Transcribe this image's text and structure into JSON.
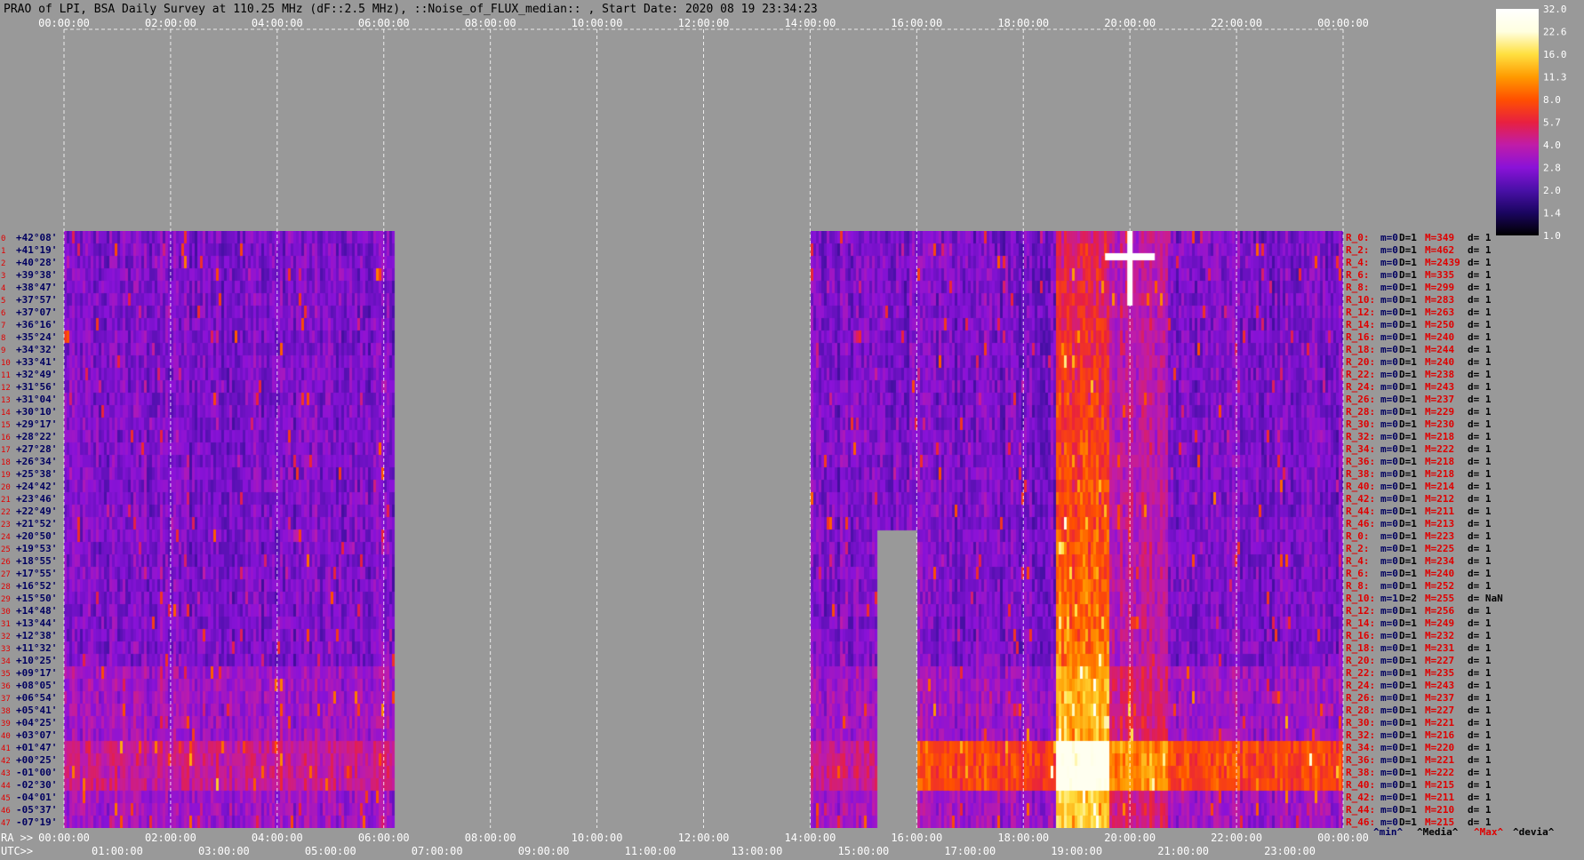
{
  "chart_data": {
    "type": "heatmap",
    "title": "PRAO of LPI, BSA Daily Survey at 110.25 MHz (dF::2.5 MHz), ::Noise_of_FLUX_median:: , Start Date: 2020 08 19 23:34:23",
    "top_axis_ticks": [
      "00:00:00",
      "02:00:00",
      "04:00:00",
      "06:00:00",
      "08:00:00",
      "10:00:00",
      "12:00:00",
      "14:00:00",
      "16:00:00",
      "18:00:00",
      "20:00:00",
      "22:00:00",
      "00:00:00"
    ],
    "ra_axis_label": "RA >>",
    "ra_axis_ticks": [
      "00:00:00",
      "02:00:00",
      "04:00:00",
      "06:00:00",
      "08:00:00",
      "10:00:00",
      "12:00:00",
      "14:00:00",
      "16:00:00",
      "18:00:00",
      "20:00:00",
      "22:00:00",
      "00:00:00"
    ],
    "utc_axis_label": "UTC>>",
    "utc_axis_ticks": [
      "01:00:00",
      "03:00:00",
      "05:00:00",
      "07:00:00",
      "09:00:00",
      "11:00:00",
      "13:00:00",
      "15:00:00",
      "17:00:00",
      "19:00:00",
      "21:00:00",
      "23:00:00"
    ],
    "declination_labels": [
      "+42°08'",
      "+41°19'",
      "+40°28'",
      "+39°38'",
      "+38°47'",
      "+37°57'",
      "+37°07'",
      "+36°16'",
      "+35°24'",
      "+34°32'",
      "+33°41'",
      "+32°49'",
      "+31°56'",
      "+31°04'",
      "+30°10'",
      "+29°17'",
      "+28°22'",
      "+27°28'",
      "+26°34'",
      "+25°38'",
      "+24°42'",
      "+23°46'",
      "+22°49'",
      "+21°52'",
      "+20°50'",
      "+19°53'",
      "+18°55'",
      "+17°55'",
      "+16°52'",
      "+15°50'",
      "+14°48'",
      "+13°44'",
      "+12°38'",
      "+11°32'",
      "+10°25'",
      "+09°17'",
      "+08°05'",
      "+06°54'",
      "+05°41'",
      "+04°25'",
      "+03°07'",
      "+01°47'",
      "+00°25'",
      "-01°00'",
      "-02°30'",
      "-04°01'",
      "-05°37'",
      "-07°19'"
    ],
    "beam_numbers": [
      "0",
      "1",
      "2",
      "3",
      "4",
      "5",
      "6",
      "7",
      "8",
      "9",
      "10",
      "11",
      "12",
      "13",
      "14",
      "15",
      "16",
      "17",
      "18",
      "19",
      "20",
      "21",
      "22",
      "23",
      "24",
      "25",
      "26",
      "27",
      "28",
      "29",
      "30",
      "31",
      "32",
      "33",
      "34",
      "35",
      "36",
      "37",
      "38",
      "39",
      "40",
      "41",
      "42",
      "43",
      "44",
      "45",
      "46",
      "47"
    ],
    "colorbar": {
      "ticks": [
        "32.0",
        "22.6",
        "16.0",
        "11.3",
        "8.0",
        "5.7",
        "4.0",
        "2.8",
        "2.0",
        "1.4",
        "1.0"
      ],
      "colors": [
        "#000000",
        "#1a0560",
        "#4a10a8",
        "#8a12d8",
        "#c01ca8",
        "#e82040",
        "#ff5000",
        "#ff9a00",
        "#ffe040",
        "#ffffe0",
        "#ffffff"
      ]
    },
    "data_ranges_utc": [
      [
        "00:00:00",
        "06:10:00"
      ],
      [
        "14:00:00",
        "00:00:00"
      ]
    ],
    "gap_utc": [
      [
        "15:00:00",
        "16:00:00"
      ]
    ],
    "stats": [
      {
        "label": "R_0:",
        "m": "m=0",
        "D": "D=1",
        "M": "M=349",
        "d": "d= 1"
      },
      {
        "label": "R_2:",
        "m": "m=0",
        "D": "D=1",
        "M": "M=462",
        "d": "d= 1"
      },
      {
        "label": "R_4:",
        "m": "m=0",
        "D": "D=1",
        "M": "M=2439",
        "d": "d= 1"
      },
      {
        "label": "R_6:",
        "m": "m=0",
        "D": "D=1",
        "M": "M=335",
        "d": "d= 1"
      },
      {
        "label": "R_8:",
        "m": "m=0",
        "D": "D=1",
        "M": "M=299",
        "d": "d= 1"
      },
      {
        "label": "R_10:",
        "m": "m=0",
        "D": "D=1",
        "M": "M=283",
        "d": "d= 1"
      },
      {
        "label": "R_12:",
        "m": "m=0",
        "D": "D=1",
        "M": "M=263",
        "d": "d= 1"
      },
      {
        "label": "R_14:",
        "m": "m=0",
        "D": "D=1",
        "M": "M=250",
        "d": "d= 1"
      },
      {
        "label": "R_16:",
        "m": "m=0",
        "D": "D=1",
        "M": "M=240",
        "d": "d= 1"
      },
      {
        "label": "R_18:",
        "m": "m=0",
        "D": "D=1",
        "M": "M=244",
        "d": "d= 1"
      },
      {
        "label": "R_20:",
        "m": "m=0",
        "D": "D=1",
        "M": "M=240",
        "d": "d= 1"
      },
      {
        "label": "R_22:",
        "m": "m=0",
        "D": "D=1",
        "M": "M=238",
        "d": "d= 1"
      },
      {
        "label": "R_24:",
        "m": "m=0",
        "D": "D=1",
        "M": "M=243",
        "d": "d= 1"
      },
      {
        "label": "R_26:",
        "m": "m=0",
        "D": "D=1",
        "M": "M=237",
        "d": "d= 1"
      },
      {
        "label": "R_28:",
        "m": "m=0",
        "D": "D=1",
        "M": "M=229",
        "d": "d= 1"
      },
      {
        "label": "R_30:",
        "m": "m=0",
        "D": "D=1",
        "M": "M=230",
        "d": "d= 1"
      },
      {
        "label": "R_32:",
        "m": "m=0",
        "D": "D=1",
        "M": "M=218",
        "d": "d= 1"
      },
      {
        "label": "R_34:",
        "m": "m=0",
        "D": "D=1",
        "M": "M=222",
        "d": "d= 1"
      },
      {
        "label": "R_36:",
        "m": "m=0",
        "D": "D=1",
        "M": "M=218",
        "d": "d= 1"
      },
      {
        "label": "R_38:",
        "m": "m=0",
        "D": "D=1",
        "M": "M=218",
        "d": "d= 1"
      },
      {
        "label": "R_40:",
        "m": "m=0",
        "D": "D=1",
        "M": "M=214",
        "d": "d= 1"
      },
      {
        "label": "R_42:",
        "m": "m=0",
        "D": "D=1",
        "M": "M=212",
        "d": "d= 1"
      },
      {
        "label": "R_44:",
        "m": "m=0",
        "D": "D=1",
        "M": "M=211",
        "d": "d= 1"
      },
      {
        "label": "R_46:",
        "m": "m=0",
        "D": "D=1",
        "M": "M=213",
        "d": "d= 1"
      },
      {
        "label": "R_0:",
        "m": "m=0",
        "D": "D=1",
        "M": "M=223",
        "d": "d= 1"
      },
      {
        "label": "R_2:",
        "m": "m=0",
        "D": "D=1",
        "M": "M=225",
        "d": "d= 1"
      },
      {
        "label": "R_4:",
        "m": "m=0",
        "D": "D=1",
        "M": "M=234",
        "d": "d= 1"
      },
      {
        "label": "R_6:",
        "m": "m=0",
        "D": "D=1",
        "M": "M=240",
        "d": "d= 1"
      },
      {
        "label": "R_8:",
        "m": "m=0",
        "D": "D=1",
        "M": "M=252",
        "d": "d= 1"
      },
      {
        "label": "R_10:",
        "m": "m=1",
        "D": "D=2",
        "M": "M=255",
        "d": "d= NaN"
      },
      {
        "label": "R_12:",
        "m": "m=0",
        "D": "D=1",
        "M": "M=256",
        "d": "d= 1"
      },
      {
        "label": "R_14:",
        "m": "m=0",
        "D": "D=1",
        "M": "M=249",
        "d": "d= 1"
      },
      {
        "label": "R_16:",
        "m": "m=0",
        "D": "D=1",
        "M": "M=232",
        "d": "d= 1"
      },
      {
        "label": "R_18:",
        "m": "m=0",
        "D": "D=1",
        "M": "M=231",
        "d": "d= 1"
      },
      {
        "label": "R_20:",
        "m": "m=0",
        "D": "D=1",
        "M": "M=227",
        "d": "d= 1"
      },
      {
        "label": "R_22:",
        "m": "m=0",
        "D": "D=1",
        "M": "M=235",
        "d": "d= 1"
      },
      {
        "label": "R_24:",
        "m": "m=0",
        "D": "D=1",
        "M": "M=243",
        "d": "d= 1"
      },
      {
        "label": "R_26:",
        "m": "m=0",
        "D": "D=1",
        "M": "M=237",
        "d": "d= 1"
      },
      {
        "label": "R_28:",
        "m": "m=0",
        "D": "D=1",
        "M": "M=227",
        "d": "d= 1"
      },
      {
        "label": "R_30:",
        "m": "m=0",
        "D": "D=1",
        "M": "M=221",
        "d": "d= 1"
      },
      {
        "label": "R_32:",
        "m": "m=0",
        "D": "D=1",
        "M": "M=216",
        "d": "d= 1"
      },
      {
        "label": "R_34:",
        "m": "m=0",
        "D": "D=1",
        "M": "M=220",
        "d": "d= 1"
      },
      {
        "label": "R_36:",
        "m": "m=0",
        "D": "D=1",
        "M": "M=221",
        "d": "d= 1"
      },
      {
        "label": "R_38:",
        "m": "m=0",
        "D": "D=1",
        "M": "M=222",
        "d": "d= 1"
      },
      {
        "label": "R_40:",
        "m": "m=0",
        "D": "D=1",
        "M": "M=215",
        "d": "d= 1"
      },
      {
        "label": "R_42:",
        "m": "m=0",
        "D": "D=1",
        "M": "M=211",
        "d": "d= 1"
      },
      {
        "label": "R_44:",
        "m": "m=0",
        "D": "D=1",
        "M": "M=210",
        "d": "d= 1"
      },
      {
        "label": "R_46:",
        "m": "m=0",
        "D": "D=1",
        "M": "M=215",
        "d": "d= 1"
      }
    ],
    "legend": {
      "min": "^min^",
      "media": "^Media^",
      "max": "^Max^",
      "devia": "^devia^"
    }
  },
  "colors": {
    "background": "#999999",
    "label_red": "#e00000",
    "label_navy": "#000060",
    "text_black": "#000000",
    "text_white": "#ffffff"
  }
}
